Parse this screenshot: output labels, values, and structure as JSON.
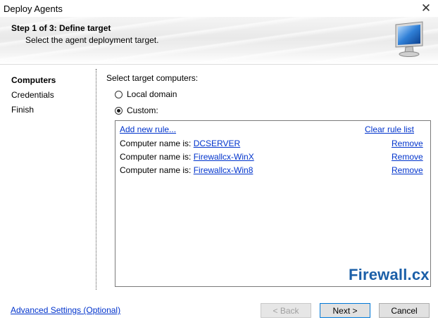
{
  "window": {
    "title": "Deploy Agents",
    "close_glyph": "✕"
  },
  "header": {
    "step": "Step 1 of 3: Define target",
    "subtitle": "Select the agent deployment target.",
    "icon": "monitor-icon"
  },
  "nav": {
    "items": [
      {
        "label": "Computers",
        "active": true
      },
      {
        "label": "Credentials",
        "active": false
      },
      {
        "label": "Finish",
        "active": false
      }
    ]
  },
  "content": {
    "label": "Select target computers:",
    "options": [
      {
        "label": "Local domain",
        "selected": false
      },
      {
        "label": "Custom:",
        "selected": true
      }
    ],
    "rules": {
      "add_link": "Add new rule...",
      "clear_link": "Clear rule list",
      "items": [
        {
          "prefix": "Computer name is:",
          "value": "DCSERVER",
          "remove": "Remove"
        },
        {
          "prefix": "Computer name is:",
          "value": "Firewallcx-WinX",
          "remove": "Remove"
        },
        {
          "prefix": "Computer name is:",
          "value": "Firewallcx-Win8",
          "remove": "Remove"
        }
      ]
    },
    "watermark": "Firewall.cx"
  },
  "footer": {
    "advanced_link": "Advanced Settings (Optional)",
    "back_label": "< Back",
    "next_label": "Next >",
    "cancel_label": "Cancel"
  },
  "colors": {
    "link": "#0033cc",
    "watermark": "#1b5fa8",
    "accent": "#0078d7"
  }
}
